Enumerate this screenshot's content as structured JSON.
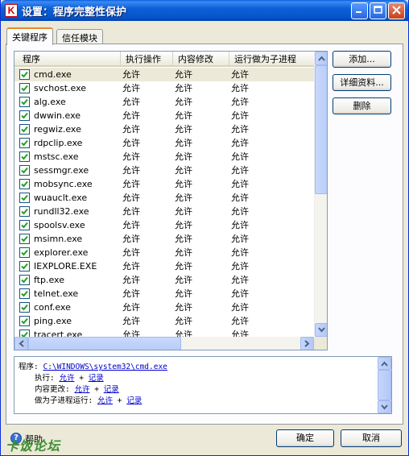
{
  "window": {
    "title": "设置：程序完整性保护",
    "icon_letter": "K"
  },
  "tabs": [
    {
      "label": "关键程序"
    },
    {
      "label": "信任模块"
    }
  ],
  "list": {
    "columns": [
      "程序",
      "执行操作",
      "内容修改",
      "运行做为子进程"
    ],
    "rows": [
      {
        "name": "cmd.exe",
        "exec": "允许",
        "modify": "允许",
        "child": "允许",
        "checked": true
      },
      {
        "name": "svchost.exe",
        "exec": "允许",
        "modify": "允许",
        "child": "允许",
        "checked": true
      },
      {
        "name": "alg.exe",
        "exec": "允许",
        "modify": "允许",
        "child": "允许",
        "checked": true
      },
      {
        "name": "dwwin.exe",
        "exec": "允许",
        "modify": "允许",
        "child": "允许",
        "checked": true
      },
      {
        "name": "regwiz.exe",
        "exec": "允许",
        "modify": "允许",
        "child": "允许",
        "checked": true
      },
      {
        "name": "rdpclip.exe",
        "exec": "允许",
        "modify": "允许",
        "child": "允许",
        "checked": true
      },
      {
        "name": "mstsc.exe",
        "exec": "允许",
        "modify": "允许",
        "child": "允许",
        "checked": true
      },
      {
        "name": "sessmgr.exe",
        "exec": "允许",
        "modify": "允许",
        "child": "允许",
        "checked": true
      },
      {
        "name": "mobsync.exe",
        "exec": "允许",
        "modify": "允许",
        "child": "允许",
        "checked": true
      },
      {
        "name": "wuauclt.exe",
        "exec": "允许",
        "modify": "允许",
        "child": "允许",
        "checked": true
      },
      {
        "name": "rundll32.exe",
        "exec": "允许",
        "modify": "允许",
        "child": "允许",
        "checked": true
      },
      {
        "name": "spoolsv.exe",
        "exec": "允许",
        "modify": "允许",
        "child": "允许",
        "checked": true
      },
      {
        "name": "msimn.exe",
        "exec": "允许",
        "modify": "允许",
        "child": "允许",
        "checked": true
      },
      {
        "name": "explorer.exe",
        "exec": "允许",
        "modify": "允许",
        "child": "允许",
        "checked": true
      },
      {
        "name": "IEXPLORE.EXE",
        "exec": "允许",
        "modify": "允许",
        "child": "允许",
        "checked": true
      },
      {
        "name": "ftp.exe",
        "exec": "允许",
        "modify": "允许",
        "child": "允许",
        "checked": true
      },
      {
        "name": "telnet.exe",
        "exec": "允许",
        "modify": "允许",
        "child": "允许",
        "checked": true
      },
      {
        "name": "conf.exe",
        "exec": "允许",
        "modify": "允许",
        "child": "允许",
        "checked": true
      },
      {
        "name": "ping.exe",
        "exec": "允许",
        "modify": "允许",
        "child": "允许",
        "checked": true
      },
      {
        "name": "tracert.exe",
        "exec": "允许",
        "modify": "允许",
        "child": "允许",
        "checked": true
      }
    ]
  },
  "buttons": {
    "add": "添加...",
    "details": "详细资料...",
    "delete": "删除",
    "ok": "确定",
    "cancel": "取消"
  },
  "detail": {
    "program_label": "程序:",
    "program_path": "C:\\WINDOWS\\system32\\cmd.exe",
    "exec_label": "执行:",
    "modify_label": "内容更改:",
    "child_label": "做为子进程运行:",
    "allow": "允许",
    "plus": "+",
    "record": "记录"
  },
  "help": {
    "label": "帮助"
  },
  "watermark": "卡饭论坛",
  "colors": {
    "title_blue": "#0553c7",
    "link": "#0000cc",
    "accent_orange": "#e68b2c"
  }
}
